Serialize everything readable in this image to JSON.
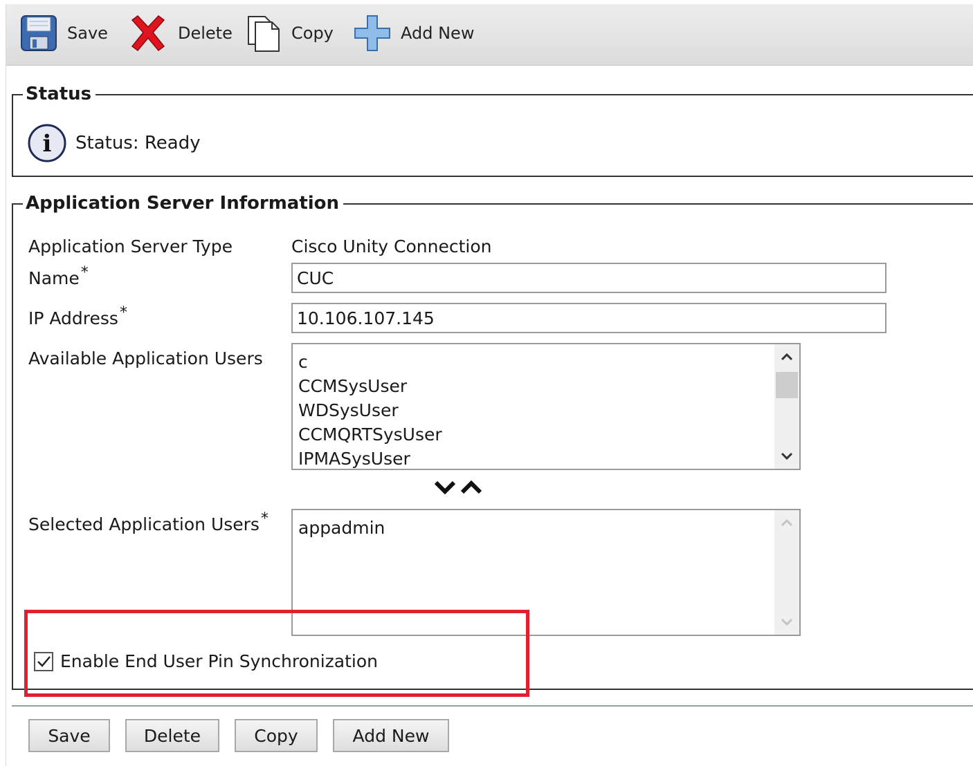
{
  "toolbar": {
    "save_label": "Save",
    "delete_label": "Delete",
    "copy_label": "Copy",
    "add_new_label": "Add New"
  },
  "status": {
    "legend": "Status",
    "text": "Status: Ready"
  },
  "app_server": {
    "legend": "Application Server Information",
    "type_label": "Application Server Type",
    "type_value": "Cisco Unity Connection",
    "name_label": "Name",
    "name_value": "CUC",
    "ip_label": "IP Address",
    "ip_value": "10.106.107.145",
    "available_label": "Available Application Users",
    "available_users": [
      "c",
      "CCMSysUser",
      "WDSysUser",
      "CCMQRTSysUser",
      "IPMASysUser"
    ],
    "selected_label": "Selected Application Users",
    "selected_users": [
      "appadmin"
    ],
    "required_marker": "*",
    "pin_sync_label": "Enable End User Pin Synchronization",
    "pin_sync_checked": true
  },
  "footer": {
    "save_label": "Save",
    "delete_label": "Delete",
    "copy_label": "Copy",
    "add_new_label": "Add New"
  },
  "colors": {
    "highlight": "#e02030",
    "delete_icon": "#e0141e",
    "add_icon": "#6aa0d8"
  }
}
